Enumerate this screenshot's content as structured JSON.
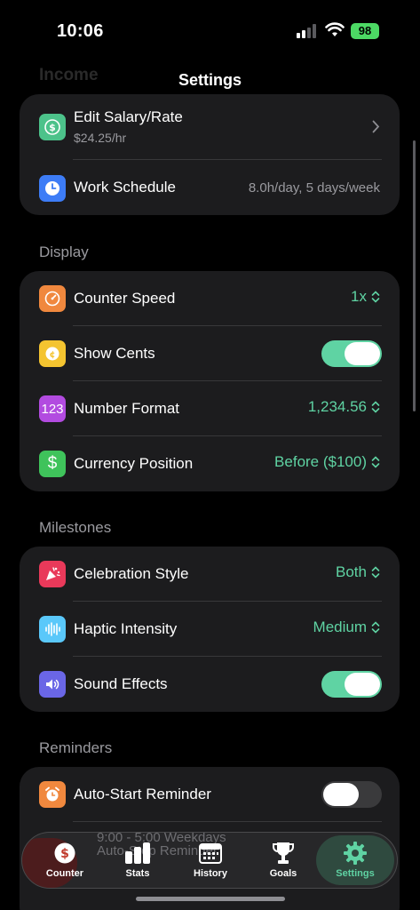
{
  "status": {
    "time": "10:06",
    "battery": "98",
    "signal_icon": "cellular-signal-icon",
    "wifi_icon": "wifi-icon"
  },
  "nav": {
    "title": "Settings",
    "ghost_header": "Income"
  },
  "income": {
    "rows": [
      {
        "label": "Edit Salary/Rate",
        "sub": "$24.25/hr",
        "icon": "dollar-icon",
        "color": "#4cc28a"
      },
      {
        "label": "Work Schedule",
        "value": "8.0h/day, 5 days/week",
        "icon": "clock-icon",
        "color": "#3d7cf6"
      }
    ]
  },
  "display": {
    "header": "Display",
    "rows": [
      {
        "label": "Counter Speed",
        "value": "1x",
        "icon": "speedometer-icon",
        "color": "#f0883e"
      },
      {
        "label": "Show Cents",
        "toggle": true,
        "icon": "cent-icon",
        "color": "#f4c430"
      },
      {
        "label": "Number Format",
        "value": "1,234.56",
        "icon_text": "123",
        "icon": "number-format-icon",
        "color": "#b24be0"
      },
      {
        "label": "Currency Position",
        "value": "Before ($100)",
        "icon_text": "$",
        "icon": "currency-icon",
        "color": "#3fc35b"
      }
    ]
  },
  "milestones": {
    "header": "Milestones",
    "rows": [
      {
        "label": "Celebration Style",
        "value": "Both",
        "icon": "party-popper-icon",
        "color": "#e9395a"
      },
      {
        "label": "Haptic Intensity",
        "value": "Medium",
        "icon": "waveform-icon",
        "color": "#5ac8fa"
      },
      {
        "label": "Sound Effects",
        "toggle": true,
        "icon": "speaker-icon",
        "color": "#6a66e6"
      }
    ]
  },
  "reminders": {
    "header": "Reminders",
    "rows": [
      {
        "label": "Auto-Start Reminder",
        "toggle": false,
        "icon": "alarm-clock-icon",
        "color": "#f0883e"
      }
    ],
    "ghost_1": "9:00 - 5:00 Weekdays",
    "ghost_2": "Auto-Stop Reminder"
  },
  "tabbar": {
    "tabs": [
      {
        "label": "Counter",
        "icon": "dollar-coin-icon"
      },
      {
        "label": "Stats",
        "icon": "bar-chart-icon"
      },
      {
        "label": "History",
        "icon": "calendar-icon"
      },
      {
        "label": "Goals",
        "icon": "trophy-icon"
      },
      {
        "label": "Settings",
        "icon": "gear-icon",
        "active": true
      }
    ]
  },
  "colors": {
    "accent": "#5fd3a3",
    "card": "#1c1c1e",
    "background": "#000000"
  }
}
